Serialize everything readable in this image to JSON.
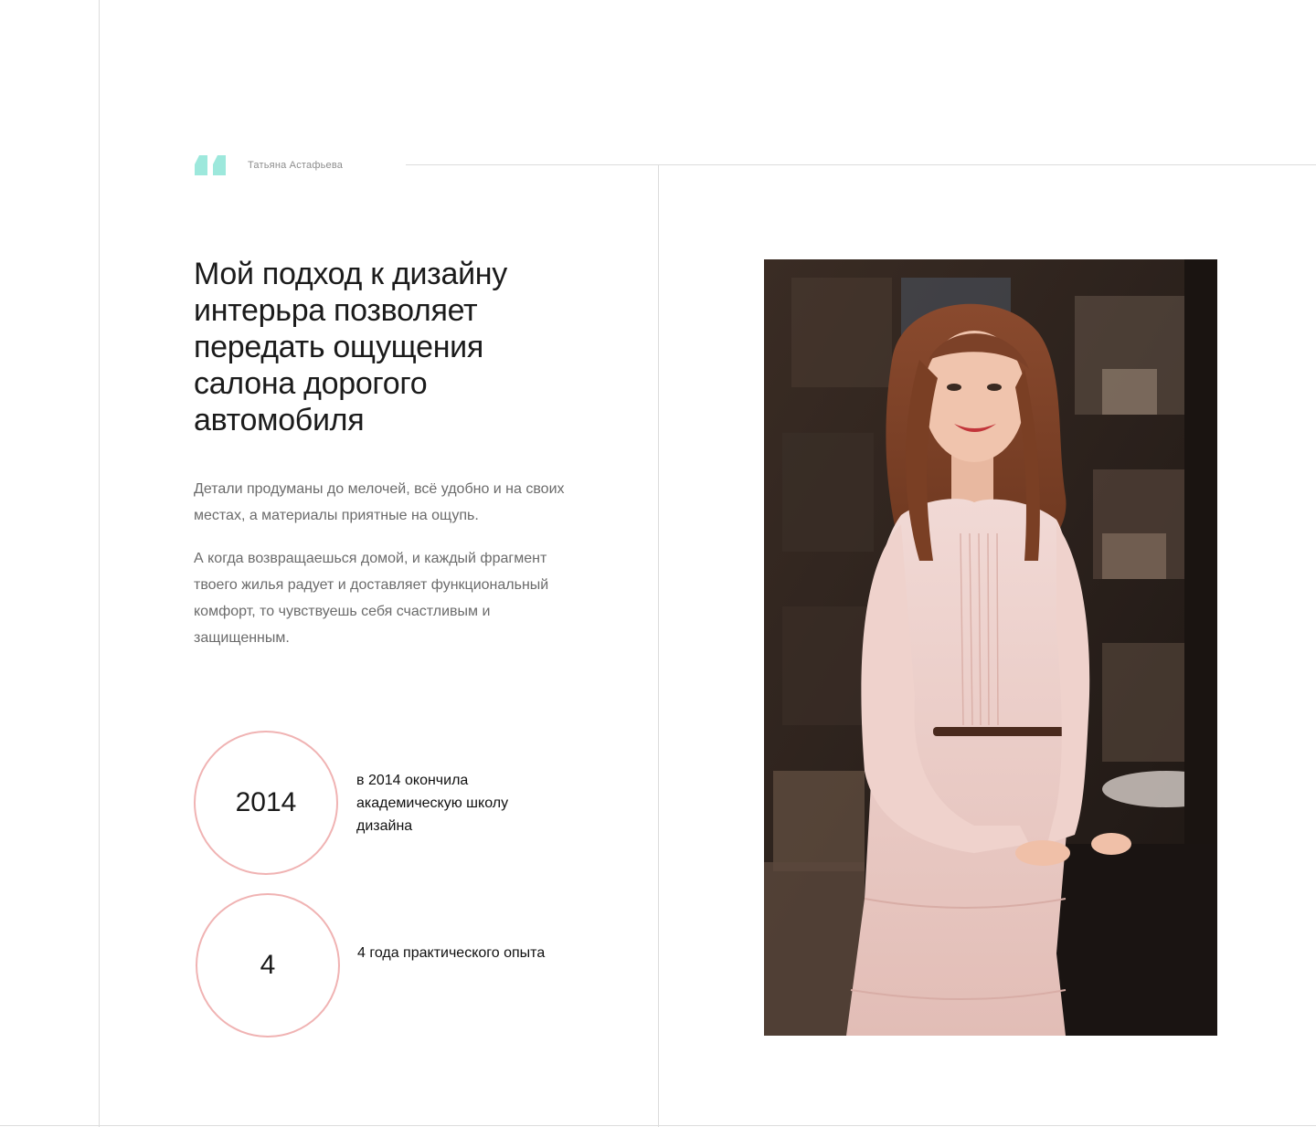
{
  "author": "Татьяна Астафьева",
  "heading": "Мой подход к дизайну интерьра позволяет передать ощущения салона дорогого автомобиля",
  "paragraphs": [
    "Детали продуманы до мелочей, всё удобно и на своих местах, а материалы приятные на ощупь.",
    "А когда возвращаешься домой, и каждый фрагмент твоего жилья радует и доставляет функциональный комфорт, то чувствуешь себя счастливым и защищенным."
  ],
  "stats": [
    {
      "value": "2014",
      "caption": "в 2014 окончила академическую школу дизайна"
    },
    {
      "value": "4",
      "caption": "4 года практического опыта"
    }
  ],
  "colors": {
    "quote_accent": "#9de8dc",
    "circle_border": "#f0b3b3",
    "divider": "#dcdcdc"
  },
  "icons": {
    "quote": "quote-mark-icon"
  },
  "photo": {
    "subject": "portrait-photo"
  }
}
